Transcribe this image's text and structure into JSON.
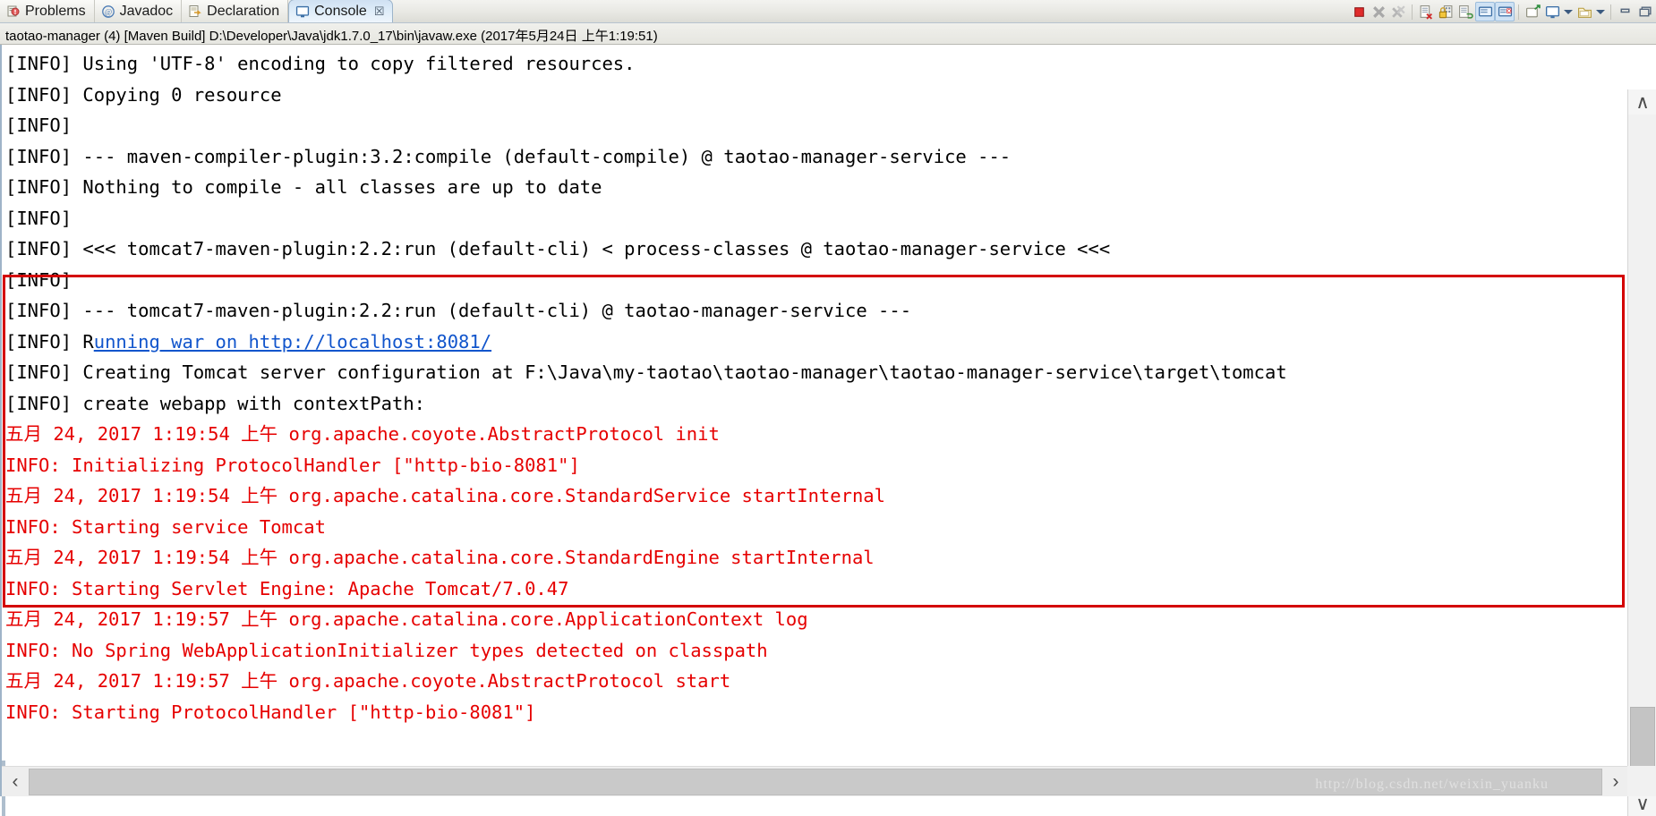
{
  "window": {
    "accent_blue": "#1155cc",
    "error_red": "#e60000",
    "highlight_box_color": "#d40000"
  },
  "tabs": [
    {
      "label": "Problems",
      "icon": "problems-icon",
      "active": false,
      "closable": false
    },
    {
      "label": "Javadoc",
      "icon": "javadoc-icon",
      "active": false,
      "closable": false
    },
    {
      "label": "Declaration",
      "icon": "declaration-icon",
      "active": false,
      "closable": false
    },
    {
      "label": "Console",
      "icon": "console-icon",
      "active": true,
      "closable": true,
      "close_glyph": "☒"
    }
  ],
  "toolbar": {
    "buttons": [
      {
        "name": "terminate-button",
        "tooltip": "Terminate",
        "enabled": true,
        "selected": false
      },
      {
        "name": "remove-launch-button",
        "tooltip": "Remove Launch",
        "enabled": false,
        "selected": false
      },
      {
        "name": "remove-all-terminated-button",
        "tooltip": "Remove All Terminated Launches",
        "enabled": false,
        "selected": false
      },
      {
        "name": "clear-console-button",
        "tooltip": "Clear Console",
        "enabled": true,
        "selected": false
      },
      {
        "name": "scroll-lock-button",
        "tooltip": "Scroll Lock",
        "enabled": true,
        "selected": false
      },
      {
        "name": "word-wrap-button",
        "tooltip": "Word Wrap",
        "enabled": true,
        "selected": false
      },
      {
        "name": "show-console-on-output-button",
        "tooltip": "Show Console When Standard Out Changes",
        "enabled": true,
        "selected": true
      },
      {
        "name": "show-console-on-error-button",
        "tooltip": "Show Console When Standard Error Changes",
        "enabled": true,
        "selected": true
      },
      {
        "name": "pin-console-button",
        "tooltip": "Pin Console",
        "enabled": true,
        "selected": false
      },
      {
        "name": "display-selected-console-button",
        "tooltip": "Display Selected Console",
        "enabled": true,
        "selected": false
      },
      {
        "name": "display-selected-console-menu",
        "tooltip": "Display Selected Console Menu",
        "enabled": true,
        "selected": false
      },
      {
        "name": "open-console-button",
        "tooltip": "Open Console",
        "enabled": true,
        "selected": false
      },
      {
        "name": "open-console-menu",
        "tooltip": "Open Console Menu",
        "enabled": true,
        "selected": false
      },
      {
        "name": "minimize-button",
        "tooltip": "Minimize",
        "enabled": true,
        "selected": false
      },
      {
        "name": "maximize-button",
        "tooltip": "Maximize",
        "enabled": true,
        "selected": false
      }
    ]
  },
  "console": {
    "title": "taotao-manager (4) [Maven Build] D:\\Developer\\Java\\jdk1.7.0_17\\bin\\javaw.exe (2017年5月24日 上午1:19:51)",
    "lines": [
      {
        "text": "[INFO] Using 'UTF-8' encoding to copy filtered resources.",
        "color": "black"
      },
      {
        "text": "[INFO] Copying 0 resource",
        "color": "black"
      },
      {
        "text": "[INFO]",
        "color": "black"
      },
      {
        "text": "[INFO] --- maven-compiler-plugin:3.2:compile (default-compile) @ taotao-manager-service ---",
        "color": "black"
      },
      {
        "text": "[INFO] Nothing to compile - all classes are up to date",
        "color": "black"
      },
      {
        "text": "[INFO]",
        "color": "black"
      },
      {
        "text": "[INFO] <<< tomcat7-maven-plugin:2.2:run (default-cli) < process-classes @ taotao-manager-service <<<",
        "color": "black"
      },
      {
        "text": "[INFO]",
        "color": "black"
      },
      {
        "text": "[INFO] --- tomcat7-maven-plugin:2.2:run (default-cli) @ taotao-manager-service ---",
        "color": "black"
      },
      {
        "prefix": "[INFO] R",
        "link": "unning war on http://localhost:8081/",
        "color": "black",
        "is_link_line": true
      },
      {
        "text": "[INFO] Creating Tomcat server configuration at F:\\Java\\my-taotao\\taotao-manager\\taotao-manager-service\\target\\tomcat",
        "color": "black"
      },
      {
        "text": "[INFO] create webapp with contextPath: ",
        "color": "black"
      },
      {
        "text": "五月 24, 2017 1:19:54 上午 org.apache.coyote.AbstractProtocol init",
        "color": "red"
      },
      {
        "text": "INFO: Initializing ProtocolHandler [\"http-bio-8081\"]",
        "color": "red"
      },
      {
        "text": "五月 24, 2017 1:19:54 上午 org.apache.catalina.core.StandardService startInternal",
        "color": "red"
      },
      {
        "text": "INFO: Starting service Tomcat",
        "color": "red"
      },
      {
        "text": "五月 24, 2017 1:19:54 上午 org.apache.catalina.core.StandardEngine startInternal",
        "color": "red"
      },
      {
        "text": "INFO: Starting Servlet Engine: Apache Tomcat/7.0.47",
        "color": "red"
      },
      {
        "text": "五月 24, 2017 1:19:57 上午 org.apache.catalina.core.ApplicationContext log",
        "color": "red"
      },
      {
        "text": "INFO: No Spring WebApplicationInitializer types detected on classpath",
        "color": "red"
      },
      {
        "text": "五月 24, 2017 1:19:57 上午 org.apache.coyote.AbstractProtocol start",
        "color": "red"
      },
      {
        "text": "INFO: Starting ProtocolHandler [\"http-bio-8081\"]",
        "color": "red"
      }
    ]
  },
  "scrollbars": {
    "vertical": {
      "up_glyph": "∧",
      "down_glyph": "∨"
    },
    "horizontal": {
      "left_glyph": "‹",
      "right_glyph": "›"
    }
  },
  "watermark": {
    "text": "http://blog.csdn.net/weixin_yuanku"
  }
}
